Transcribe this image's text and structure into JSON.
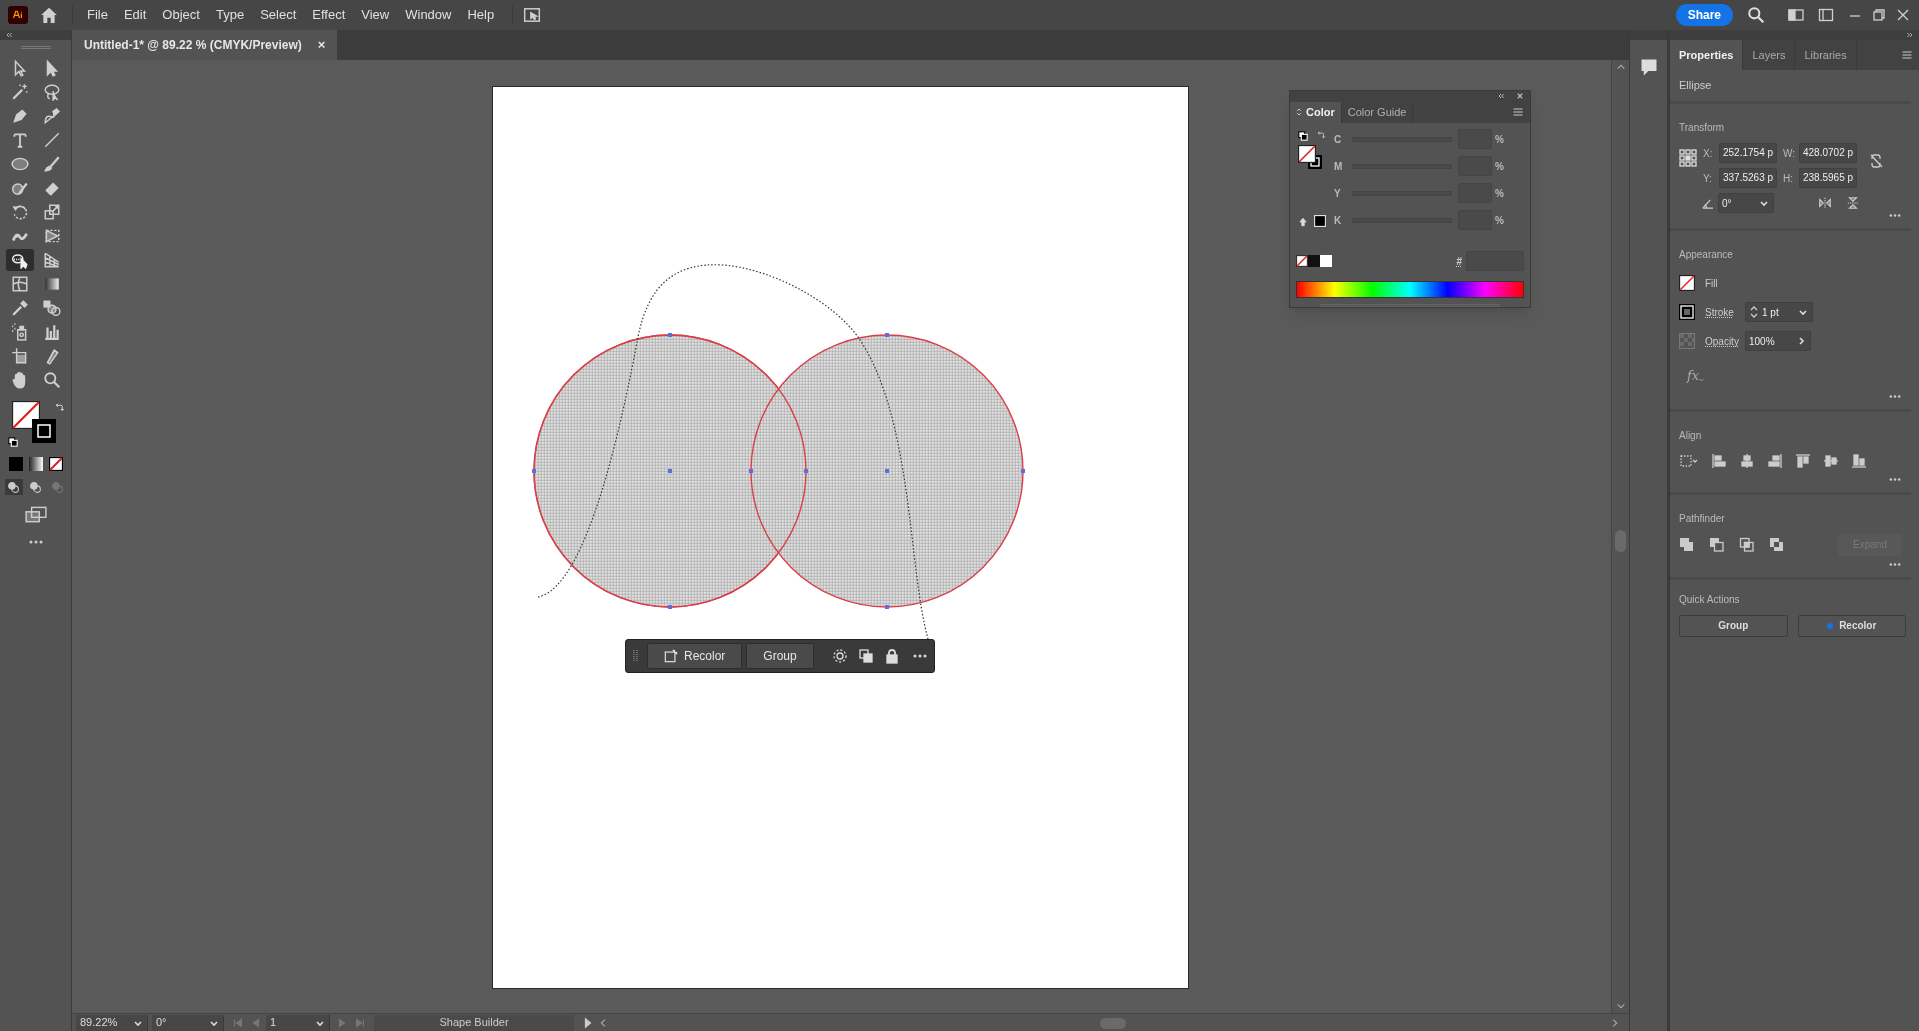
{
  "menu_bar": {
    "items": [
      "File",
      "Edit",
      "Object",
      "Type",
      "Select",
      "Effect",
      "View",
      "Window",
      "Help"
    ],
    "share_button": "Share"
  },
  "document_tab": {
    "title": "Untitled-1* @ 89.22 % (CMYK/Preview)",
    "close": "×"
  },
  "tools": [
    {
      "kind": "selection",
      "selected": false
    },
    {
      "kind": "direct",
      "selected": false
    },
    {
      "kind": "wand",
      "selected": false
    },
    {
      "kind": "lasso",
      "selected": false
    },
    {
      "kind": "pen",
      "selected": false
    },
    {
      "kind": "curvature",
      "selected": false
    },
    {
      "kind": "type",
      "selected": false
    },
    {
      "kind": "line",
      "selected": false
    },
    {
      "kind": "ellipse",
      "selected": false
    },
    {
      "kind": "brush",
      "selected": false
    },
    {
      "kind": "shaper",
      "selected": false
    },
    {
      "kind": "eraser",
      "selected": false
    },
    {
      "kind": "rotate",
      "selected": false
    },
    {
      "kind": "scale",
      "selected": false
    },
    {
      "kind": "puppet",
      "selected": false
    },
    {
      "kind": "freetransform",
      "selected": false
    },
    {
      "kind": "shapebuilder",
      "selected": true
    },
    {
      "kind": "perspective",
      "selected": false
    },
    {
      "kind": "mesh",
      "selected": false
    },
    {
      "kind": "gradient",
      "selected": false
    },
    {
      "kind": "eyedropper",
      "selected": false
    },
    {
      "kind": "blend",
      "selected": false
    },
    {
      "kind": "sprayer",
      "selected": false
    },
    {
      "kind": "graph",
      "selected": false
    },
    {
      "kind": "artboard",
      "selected": false
    },
    {
      "kind": "knife",
      "selected": false
    },
    {
      "kind": "hand",
      "selected": false
    },
    {
      "kind": "zoom",
      "selected": false
    }
  ],
  "color_panel": {
    "tabs": [
      {
        "label": "Color",
        "selected": true
      },
      {
        "label": "Color Guide",
        "selected": false
      }
    ],
    "channels": [
      {
        "label": "C",
        "unit": "%"
      },
      {
        "label": "M",
        "unit": "%"
      },
      {
        "label": "Y",
        "unit": "%"
      },
      {
        "label": "K",
        "unit": "%"
      }
    ],
    "hex_label": "#"
  },
  "context_toolbar": {
    "buttons": [
      "Recolor",
      "Group"
    ]
  },
  "properties": {
    "tabs": [
      {
        "label": "Properties",
        "selected": true
      },
      {
        "label": "Layers",
        "selected": false
      },
      {
        "label": "Libraries",
        "selected": false
      }
    ],
    "object_type": "Ellipse",
    "transform": {
      "title": "Transform",
      "fields": [
        {
          "label": "X:",
          "value": "252.1754 p"
        },
        {
          "label": "W:",
          "value": "428.0702 p"
        },
        {
          "label": "Y:",
          "value": "337.5263 p"
        },
        {
          "label": "H:",
          "value": "238.5965 p"
        }
      ],
      "angle": "0°"
    },
    "appearance": {
      "title": "Appearance",
      "fill_label": "Fill",
      "stroke_label": "Stroke",
      "stroke_weight": "1 pt",
      "opacity_label": "Opacity",
      "opacity": "100%",
      "effects_label": "fx"
    },
    "align": {
      "title": "Align"
    },
    "pathfinder": {
      "title": "Pathfinder",
      "expand": {
        "label": "Expand",
        "disabled": true
      }
    },
    "quick_actions": {
      "title": "Quick Actions",
      "buttons": [
        {
          "label": "Group",
          "kind": "plain"
        },
        {
          "label": "Recolor",
          "kind": "dot"
        }
      ]
    }
  },
  "status_bar": {
    "zoom": "89.22%",
    "rotation": "0°",
    "artboard": "1",
    "tool": "Shape Builder"
  }
}
